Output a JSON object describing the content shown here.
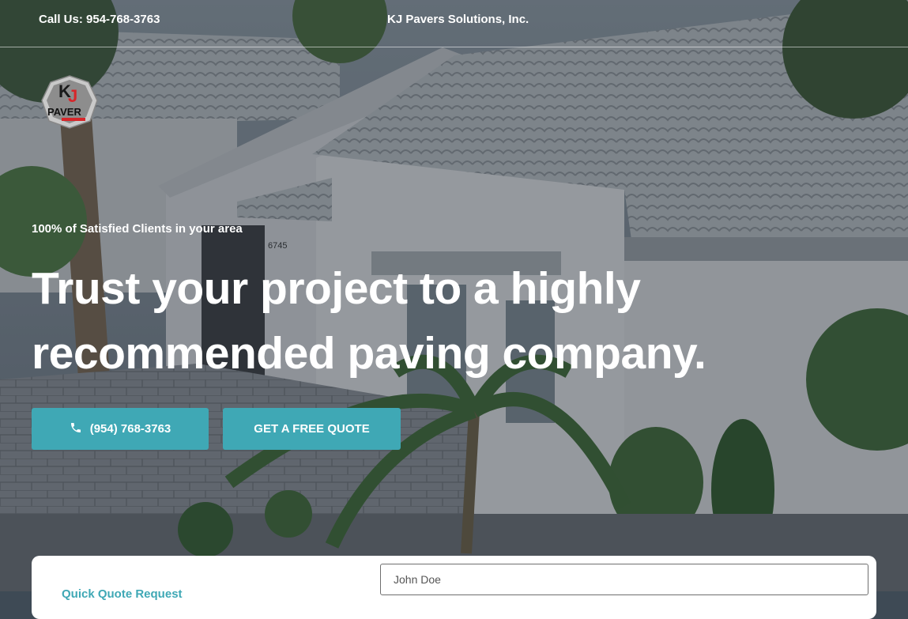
{
  "topbar": {
    "call_text": "Call Us: 954-768-3763",
    "company_name": "KJ Pavers Solutions, Inc."
  },
  "logo": {
    "letters": "KJ",
    "word": "PAVER",
    "small": "SOLUTIONS"
  },
  "hero": {
    "tagline": "100% of Satisfied Clients in your area",
    "headline": "Trust your project to a highly recommended paving company.",
    "house_number": "6745",
    "phone_button": "(954) 768-3763",
    "quote_button": "GET A FREE QUOTE"
  },
  "form": {
    "title": "Quick Quote Request",
    "name_placeholder": "John Doe"
  },
  "colors": {
    "accent": "#3fa8b5",
    "overlay": "#1c2630"
  },
  "icons": {
    "phone": "phone-icon"
  }
}
